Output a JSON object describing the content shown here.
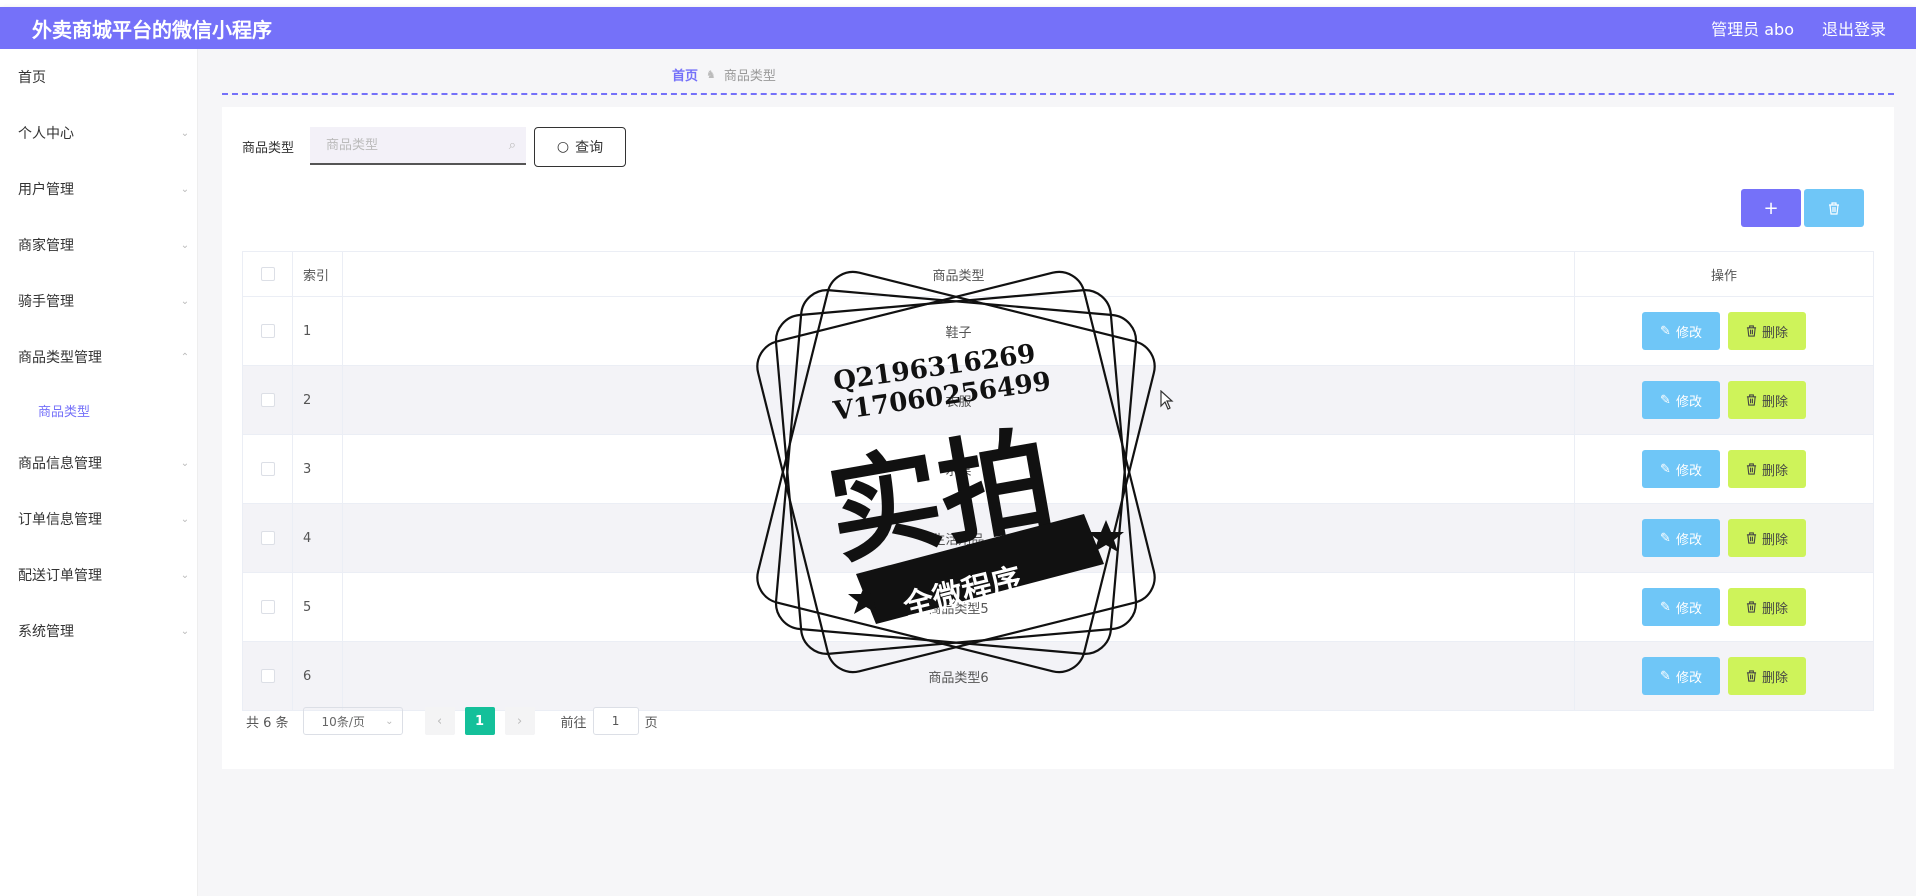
{
  "app": {
    "title": "外卖商城平台的微信小程序"
  },
  "header": {
    "user_label": "管理员 abo",
    "logout_label": "退出登录"
  },
  "sidebar": {
    "items": [
      {
        "label": "首页"
      },
      {
        "label": "个人中心"
      },
      {
        "label": "用户管理"
      },
      {
        "label": "商家管理"
      },
      {
        "label": "骑手管理"
      },
      {
        "label": "商品类型管理"
      },
      {
        "label": "商品类型"
      },
      {
        "label": "商品信息管理"
      },
      {
        "label": "订单信息管理"
      },
      {
        "label": "配送订单管理"
      },
      {
        "label": "系统管理"
      }
    ]
  },
  "breadcrumb": {
    "home": "首页",
    "current": "商品类型"
  },
  "search": {
    "label": "商品类型",
    "placeholder": "商品类型",
    "value": "",
    "query_label": "查询"
  },
  "toolbar": {
    "add_symbol": "+",
    "delete_icon": "trash-icon"
  },
  "table": {
    "headers": {
      "index": "索引",
      "type": "商品类型",
      "op": "操作"
    },
    "rows": [
      {
        "index": "1",
        "type": "鞋子"
      },
      {
        "index": "2",
        "type": "衣服"
      },
      {
        "index": "3",
        "type": "水果"
      },
      {
        "index": "4",
        "type": "生活用品"
      },
      {
        "index": "5",
        "type": "商品类型5"
      },
      {
        "index": "6",
        "type": "商品类型6"
      }
    ],
    "edit_label": "修改",
    "delete_label": "删除"
  },
  "pagination": {
    "total": "共 6 条",
    "page_size": "10条/页",
    "current": "1",
    "goto_label": "前往",
    "goto_value": "1",
    "page_suffix": "页"
  },
  "watermark": {
    "line1": "Q2196316269",
    "line2": "V17060256499",
    "big": "实拍",
    "banner": "全微程序"
  },
  "colors": {
    "primary": "#7571f9",
    "info": "#6fc6f7",
    "lime": "#cef35a",
    "pager": "#14c09a"
  }
}
